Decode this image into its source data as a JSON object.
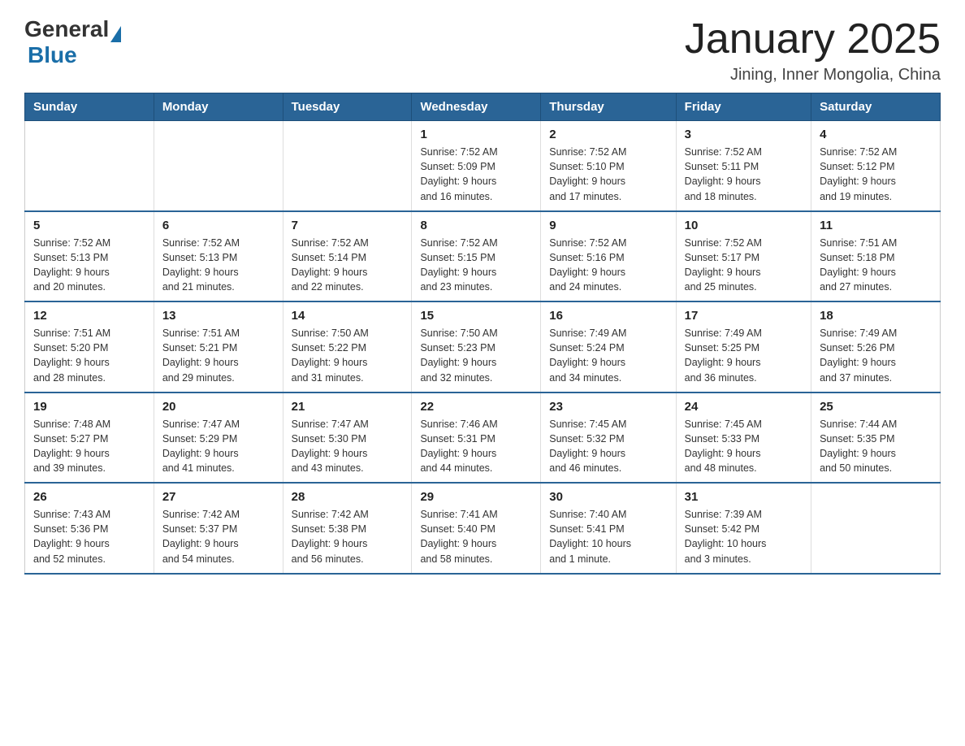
{
  "logo": {
    "general": "General",
    "blue": "Blue"
  },
  "title": "January 2025",
  "location": "Jining, Inner Mongolia, China",
  "days_of_week": [
    "Sunday",
    "Monday",
    "Tuesday",
    "Wednesday",
    "Thursday",
    "Friday",
    "Saturday"
  ],
  "weeks": [
    [
      {
        "day": "",
        "info": ""
      },
      {
        "day": "",
        "info": ""
      },
      {
        "day": "",
        "info": ""
      },
      {
        "day": "1",
        "info": "Sunrise: 7:52 AM\nSunset: 5:09 PM\nDaylight: 9 hours\nand 16 minutes."
      },
      {
        "day": "2",
        "info": "Sunrise: 7:52 AM\nSunset: 5:10 PM\nDaylight: 9 hours\nand 17 minutes."
      },
      {
        "day": "3",
        "info": "Sunrise: 7:52 AM\nSunset: 5:11 PM\nDaylight: 9 hours\nand 18 minutes."
      },
      {
        "day": "4",
        "info": "Sunrise: 7:52 AM\nSunset: 5:12 PM\nDaylight: 9 hours\nand 19 minutes."
      }
    ],
    [
      {
        "day": "5",
        "info": "Sunrise: 7:52 AM\nSunset: 5:13 PM\nDaylight: 9 hours\nand 20 minutes."
      },
      {
        "day": "6",
        "info": "Sunrise: 7:52 AM\nSunset: 5:13 PM\nDaylight: 9 hours\nand 21 minutes."
      },
      {
        "day": "7",
        "info": "Sunrise: 7:52 AM\nSunset: 5:14 PM\nDaylight: 9 hours\nand 22 minutes."
      },
      {
        "day": "8",
        "info": "Sunrise: 7:52 AM\nSunset: 5:15 PM\nDaylight: 9 hours\nand 23 minutes."
      },
      {
        "day": "9",
        "info": "Sunrise: 7:52 AM\nSunset: 5:16 PM\nDaylight: 9 hours\nand 24 minutes."
      },
      {
        "day": "10",
        "info": "Sunrise: 7:52 AM\nSunset: 5:17 PM\nDaylight: 9 hours\nand 25 minutes."
      },
      {
        "day": "11",
        "info": "Sunrise: 7:51 AM\nSunset: 5:18 PM\nDaylight: 9 hours\nand 27 minutes."
      }
    ],
    [
      {
        "day": "12",
        "info": "Sunrise: 7:51 AM\nSunset: 5:20 PM\nDaylight: 9 hours\nand 28 minutes."
      },
      {
        "day": "13",
        "info": "Sunrise: 7:51 AM\nSunset: 5:21 PM\nDaylight: 9 hours\nand 29 minutes."
      },
      {
        "day": "14",
        "info": "Sunrise: 7:50 AM\nSunset: 5:22 PM\nDaylight: 9 hours\nand 31 minutes."
      },
      {
        "day": "15",
        "info": "Sunrise: 7:50 AM\nSunset: 5:23 PM\nDaylight: 9 hours\nand 32 minutes."
      },
      {
        "day": "16",
        "info": "Sunrise: 7:49 AM\nSunset: 5:24 PM\nDaylight: 9 hours\nand 34 minutes."
      },
      {
        "day": "17",
        "info": "Sunrise: 7:49 AM\nSunset: 5:25 PM\nDaylight: 9 hours\nand 36 minutes."
      },
      {
        "day": "18",
        "info": "Sunrise: 7:49 AM\nSunset: 5:26 PM\nDaylight: 9 hours\nand 37 minutes."
      }
    ],
    [
      {
        "day": "19",
        "info": "Sunrise: 7:48 AM\nSunset: 5:27 PM\nDaylight: 9 hours\nand 39 minutes."
      },
      {
        "day": "20",
        "info": "Sunrise: 7:47 AM\nSunset: 5:29 PM\nDaylight: 9 hours\nand 41 minutes."
      },
      {
        "day": "21",
        "info": "Sunrise: 7:47 AM\nSunset: 5:30 PM\nDaylight: 9 hours\nand 43 minutes."
      },
      {
        "day": "22",
        "info": "Sunrise: 7:46 AM\nSunset: 5:31 PM\nDaylight: 9 hours\nand 44 minutes."
      },
      {
        "day": "23",
        "info": "Sunrise: 7:45 AM\nSunset: 5:32 PM\nDaylight: 9 hours\nand 46 minutes."
      },
      {
        "day": "24",
        "info": "Sunrise: 7:45 AM\nSunset: 5:33 PM\nDaylight: 9 hours\nand 48 minutes."
      },
      {
        "day": "25",
        "info": "Sunrise: 7:44 AM\nSunset: 5:35 PM\nDaylight: 9 hours\nand 50 minutes."
      }
    ],
    [
      {
        "day": "26",
        "info": "Sunrise: 7:43 AM\nSunset: 5:36 PM\nDaylight: 9 hours\nand 52 minutes."
      },
      {
        "day": "27",
        "info": "Sunrise: 7:42 AM\nSunset: 5:37 PM\nDaylight: 9 hours\nand 54 minutes."
      },
      {
        "day": "28",
        "info": "Sunrise: 7:42 AM\nSunset: 5:38 PM\nDaylight: 9 hours\nand 56 minutes."
      },
      {
        "day": "29",
        "info": "Sunrise: 7:41 AM\nSunset: 5:40 PM\nDaylight: 9 hours\nand 58 minutes."
      },
      {
        "day": "30",
        "info": "Sunrise: 7:40 AM\nSunset: 5:41 PM\nDaylight: 10 hours\nand 1 minute."
      },
      {
        "day": "31",
        "info": "Sunrise: 7:39 AM\nSunset: 5:42 PM\nDaylight: 10 hours\nand 3 minutes."
      },
      {
        "day": "",
        "info": ""
      }
    ]
  ]
}
